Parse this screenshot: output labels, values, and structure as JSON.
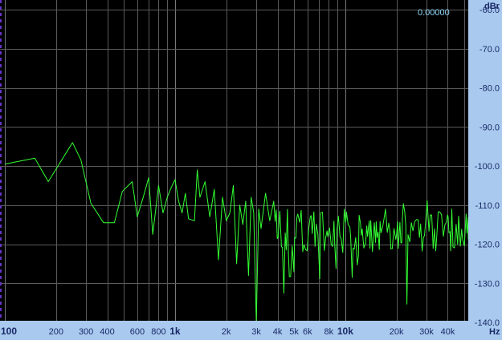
{
  "chart_data": {
    "type": "line",
    "title": "",
    "xlabel": "Hz",
    "ylabel": "dBr",
    "x_scale": "log",
    "xlim": [
      100,
      50000
    ],
    "ylim": [
      -140,
      -60
    ],
    "grid": true,
    "readout": "0.00000",
    "x_ticks": [
      {
        "value": 100,
        "label": "100",
        "major": true
      },
      {
        "value": 200,
        "label": "200",
        "major": false
      },
      {
        "value": 300,
        "label": "300",
        "major": false
      },
      {
        "value": 400,
        "label": "400",
        "major": false
      },
      {
        "value": 600,
        "label": "600",
        "major": false
      },
      {
        "value": 800,
        "label": "800",
        "major": false
      },
      {
        "value": 1000,
        "label": "1k",
        "major": true
      },
      {
        "value": 2000,
        "label": "2k",
        "major": false
      },
      {
        "value": 3000,
        "label": "3k",
        "major": false
      },
      {
        "value": 4000,
        "label": "4k",
        "major": false
      },
      {
        "value": 5000,
        "label": "5k",
        "major": false
      },
      {
        "value": 6000,
        "label": "6k",
        "major": false
      },
      {
        "value": 8000,
        "label": "8k",
        "major": false
      },
      {
        "value": 10000,
        "label": "10k",
        "major": true
      },
      {
        "value": 20000,
        "label": "20k",
        "major": false
      },
      {
        "value": 30000,
        "label": "30k",
        "major": false
      },
      {
        "value": 40000,
        "label": "40k",
        "major": false
      }
    ],
    "y_ticks": [
      {
        "value": -60,
        "label": "-60.0"
      },
      {
        "value": -70,
        "label": "-70.0"
      },
      {
        "value": -80,
        "label": "-80.0"
      },
      {
        "value": -90,
        "label": "-90.0"
      },
      {
        "value": -100,
        "label": "-100.0"
      },
      {
        "value": -110,
        "label": "-110.0"
      },
      {
        "value": -120,
        "label": "-120.0"
      },
      {
        "value": -130,
        "label": "-130.0"
      },
      {
        "value": -140,
        "label": "-140.0"
      }
    ],
    "colors": {
      "trace": "#33ff33",
      "grid": "#5a5a5a",
      "axis_panel": "#a9c9ef",
      "tick_text": "#1a2a66",
      "readout": "#8fd8f8",
      "left_marker": "#6633cc"
    },
    "series": [
      {
        "x": [
          100,
          150,
          180,
          250,
          280,
          320,
          380,
          440,
          490,
          560,
          600,
          650,
          700,
          740,
          800,
          850,
          900,
          950,
          1000,
          1050,
          1100,
          1150,
          1200,
          1300,
          1350,
          1400,
          1500,
          1600,
          1700,
          1800,
          1900,
          2000,
          2100,
          2200,
          2300,
          2400,
          2500,
          2600,
          2700,
          2800,
          2900,
          3000,
          3100,
          3200,
          3400,
          3600,
          3800
        ],
        "y": [
          -99.5,
          -98,
          -104,
          -94,
          -98.5,
          -109.5,
          -114.5,
          -114.5,
          -106.5,
          -104,
          -113,
          -108,
          -103,
          -117.5,
          -105,
          -112,
          -108,
          -105.5,
          -103.5,
          -109,
          -112,
          -107,
          -113.5,
          -114,
          -101,
          -108,
          -104,
          -113,
          -106,
          -124,
          -108,
          -114,
          -112,
          -105,
          -125,
          -110,
          -115,
          -109,
          -128,
          -108,
          -112,
          -140,
          -111,
          -116,
          -107,
          -114,
          -109
        ]
      }
    ]
  }
}
